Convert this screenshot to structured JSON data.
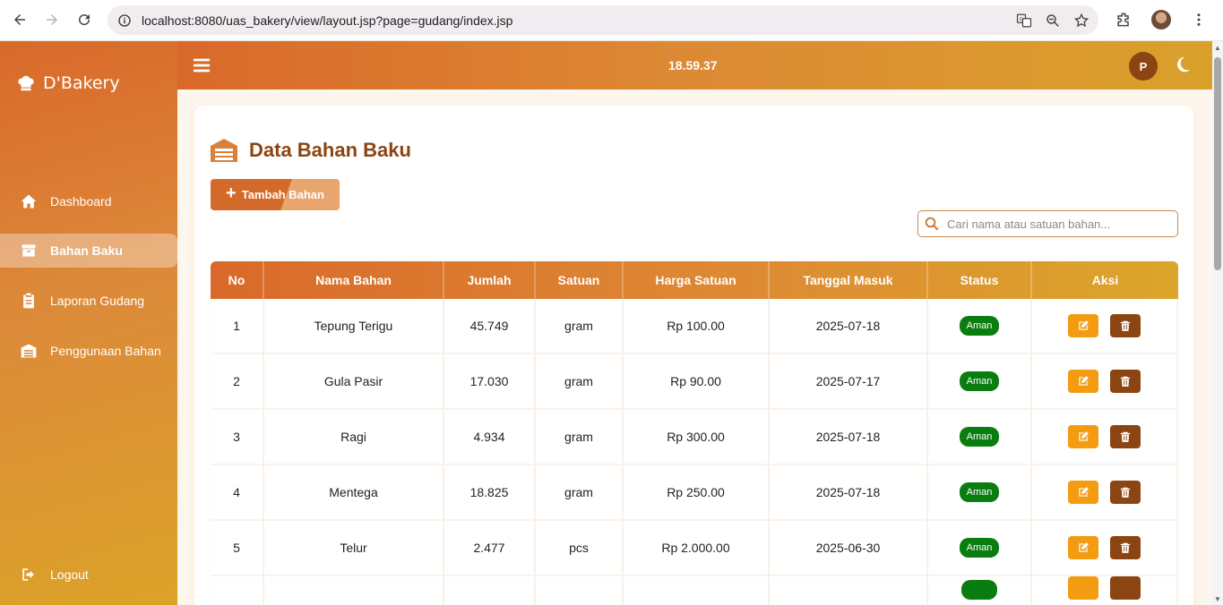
{
  "browser": {
    "url": "localhost:8080/uas_bakery/view/layout.jsp?page=gudang/index.jsp"
  },
  "sidebar": {
    "brand": "D'Bakery",
    "items": [
      {
        "label": "Dashboard",
        "icon": "home-icon"
      },
      {
        "label": "Bahan Baku",
        "icon": "box-icon",
        "active": true
      },
      {
        "label": "Laporan Gudang",
        "icon": "clipboard-icon"
      },
      {
        "label": "Penggunaan Bahan",
        "icon": "warehouse-icon"
      }
    ],
    "logout": "Logout"
  },
  "topbar": {
    "time": "18.59.37",
    "user_initial": "P"
  },
  "main": {
    "title": "Data Bahan Baku",
    "add_button": "Tambah Bahan",
    "search_placeholder": "Cari nama atau satuan bahan..."
  },
  "table": {
    "headers": [
      "No",
      "Nama Bahan",
      "Jumlah",
      "Satuan",
      "Harga Satuan",
      "Tanggal Masuk",
      "Status",
      "Aksi"
    ],
    "rows": [
      {
        "no": "1",
        "nama": "Tepung Terigu",
        "jumlah": "45.749",
        "satuan": "gram",
        "harga": "Rp 100.00",
        "tanggal": "2025-07-18",
        "status": "Aman"
      },
      {
        "no": "2",
        "nama": "Gula Pasir",
        "jumlah": "17.030",
        "satuan": "gram",
        "harga": "Rp 90.00",
        "tanggal": "2025-07-17",
        "status": "Aman"
      },
      {
        "no": "3",
        "nama": "Ragi",
        "jumlah": "4.934",
        "satuan": "gram",
        "harga": "Rp 300.00",
        "tanggal": "2025-07-18",
        "status": "Aman"
      },
      {
        "no": "4",
        "nama": "Mentega",
        "jumlah": "18.825",
        "satuan": "gram",
        "harga": "Rp 250.00",
        "tanggal": "2025-07-18",
        "status": "Aman"
      },
      {
        "no": "5",
        "nama": "Telur",
        "jumlah": "2.477",
        "satuan": "pcs",
        "harga": "Rp 2.000.00",
        "tanggal": "2025-06-30",
        "status": "Aman"
      }
    ]
  },
  "colors": {
    "accent": "#d9692a",
    "brand_dark": "#8b4513",
    "status_ok": "#0a7d10",
    "edit": "#f39c12"
  }
}
